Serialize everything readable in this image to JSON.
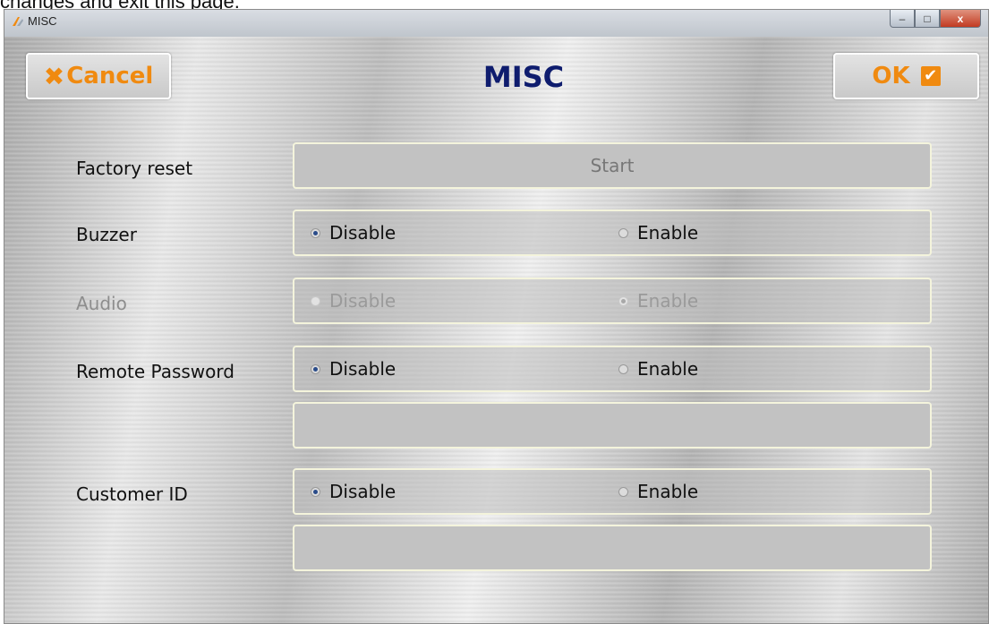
{
  "background_doc_text": "changes and exit this page.",
  "window": {
    "title": "MISC",
    "minimize_label": "–",
    "maximize_label": "□",
    "close_label": "x"
  },
  "header": {
    "cancel_label": "Cancel",
    "heading": "MISC",
    "ok_label": "OK",
    "accent_color": "#f08a10",
    "heading_color": "#0e1c6e"
  },
  "rows": {
    "factory_reset": {
      "label": "Factory reset",
      "button_label": "Start"
    },
    "buzzer": {
      "label": "Buzzer",
      "option1": "Disable",
      "option2": "Enable",
      "selected": "Disable"
    },
    "audio": {
      "label": "Audio",
      "option1": "Disable",
      "option2": "Enable",
      "selected": "Enable",
      "enabled": false
    },
    "remote_password": {
      "label": "Remote Password",
      "option1": "Disable",
      "option2": "Enable",
      "selected": "Disable",
      "input_value": ""
    },
    "customer_id": {
      "label": "Customer ID",
      "option1": "Disable",
      "option2": "Enable",
      "selected": "Disable",
      "input_value": ""
    }
  }
}
